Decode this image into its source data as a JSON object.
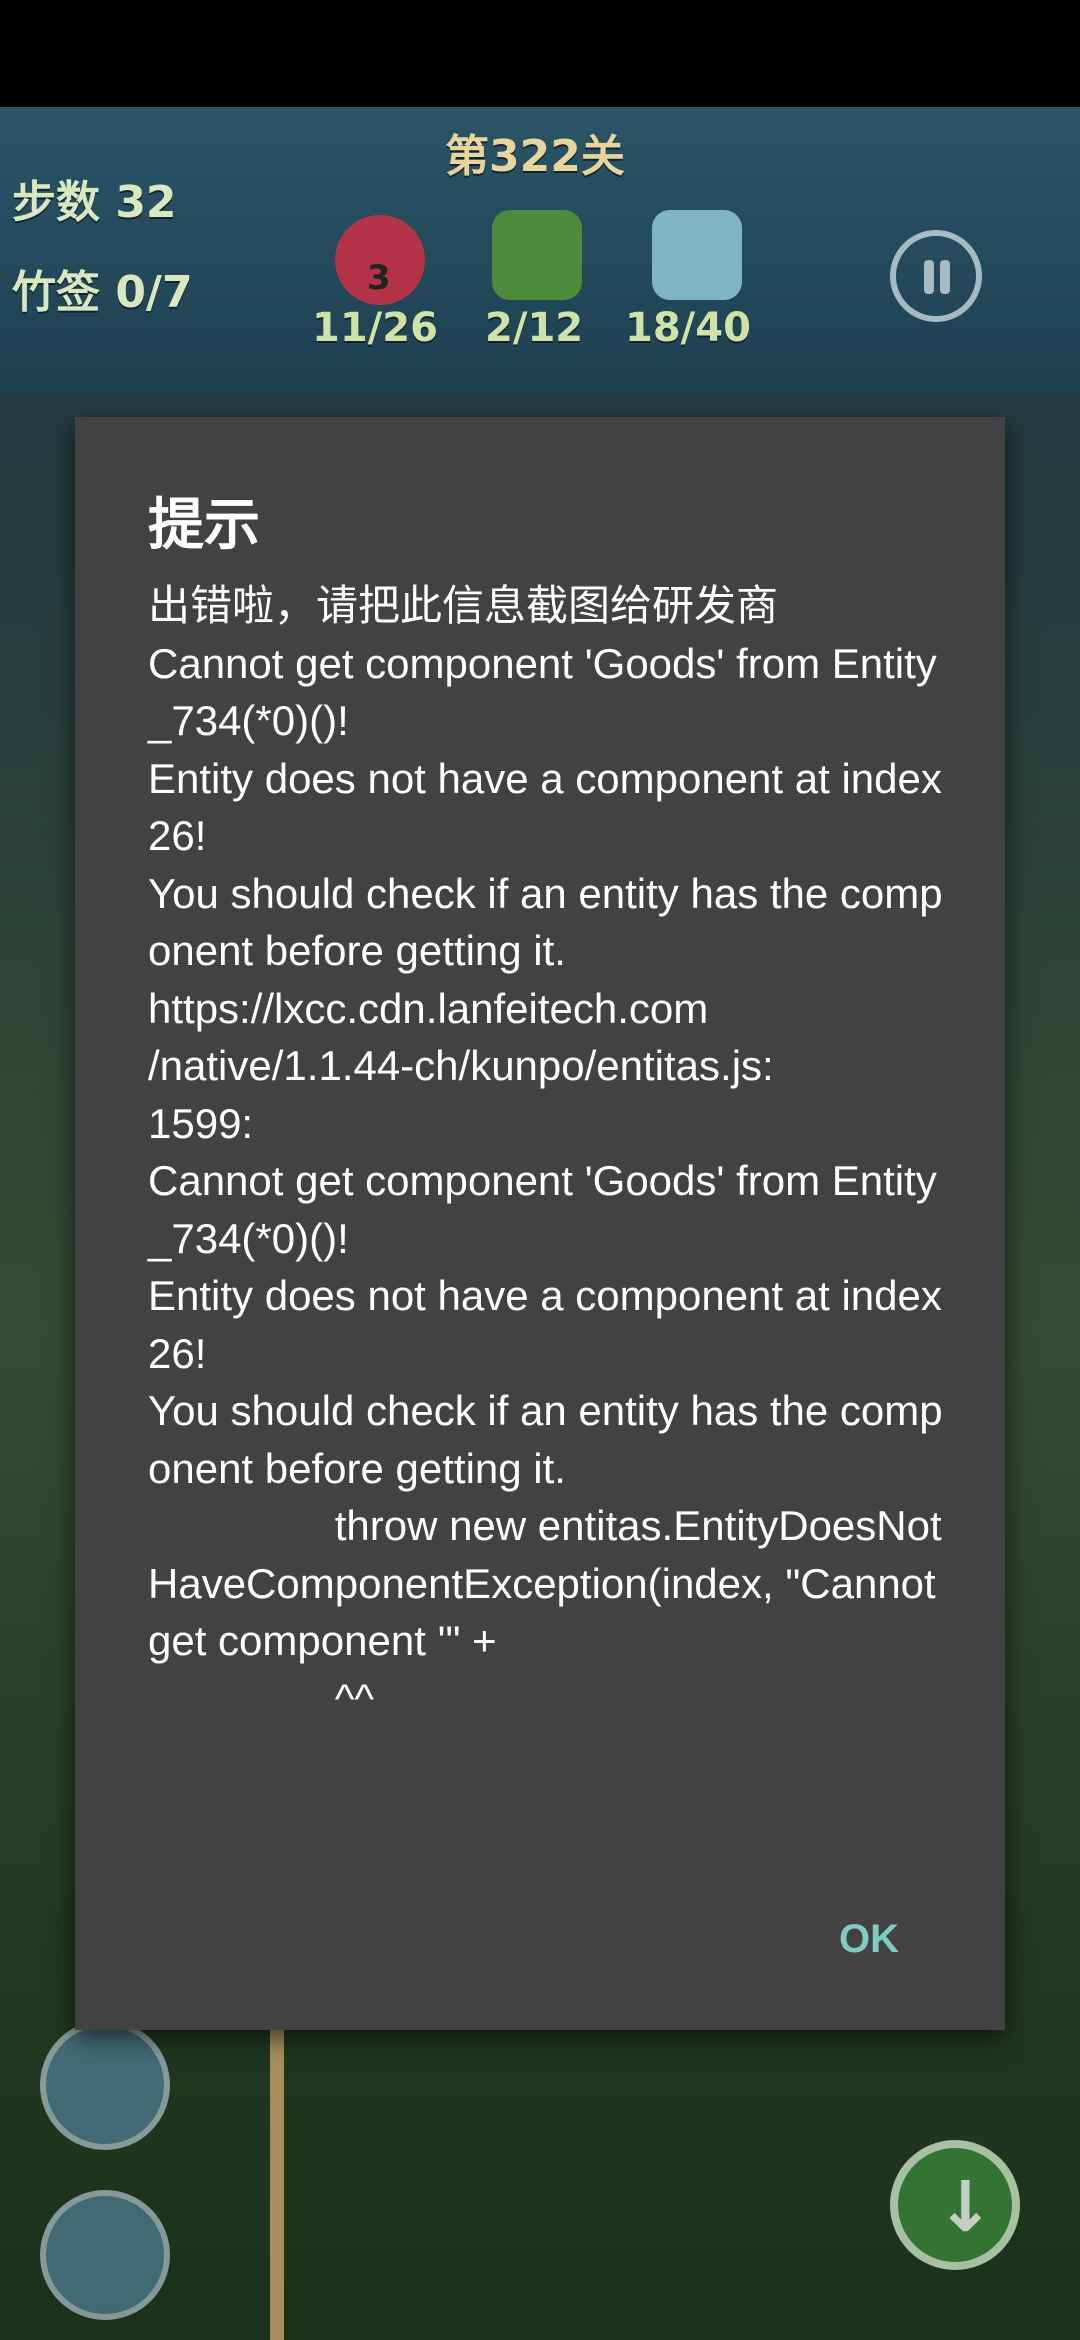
{
  "game": {
    "level": "第322关",
    "steps_label": "步数 32",
    "bamboo_label": "竹签 0/7",
    "goals": [
      {
        "icon": "red-ball-icon",
        "badge": "3",
        "progress": "11/26"
      },
      {
        "icon": "green-grass-icon",
        "progress": "2/12"
      },
      {
        "icon": "ice-block-icon",
        "progress": "18/40"
      }
    ]
  },
  "dialog": {
    "title": "提示",
    "message": "出错啦，请把此信息截图给研发商\nCannot get component 'Goods' from Entity_734(*0)()!\nEntity does not have a component at index 26!\nYou should check if an entity has the component before getting it.\nhttps://lxcc.cdn.lanfeitech.com\n/native/1.1.44-ch/kunpo/entitas.js:\n1599:\nCannot get component 'Goods' from Entity_734(*0)()!\nEntity does not have a component at index 26!\nYou should check if an entity has the component before getting it.\n                throw new entitas.EntityDoesNotHaveComponentException(index, \"Cannot get component '\" +\n                ^^",
    "ok_label": "OK"
  }
}
